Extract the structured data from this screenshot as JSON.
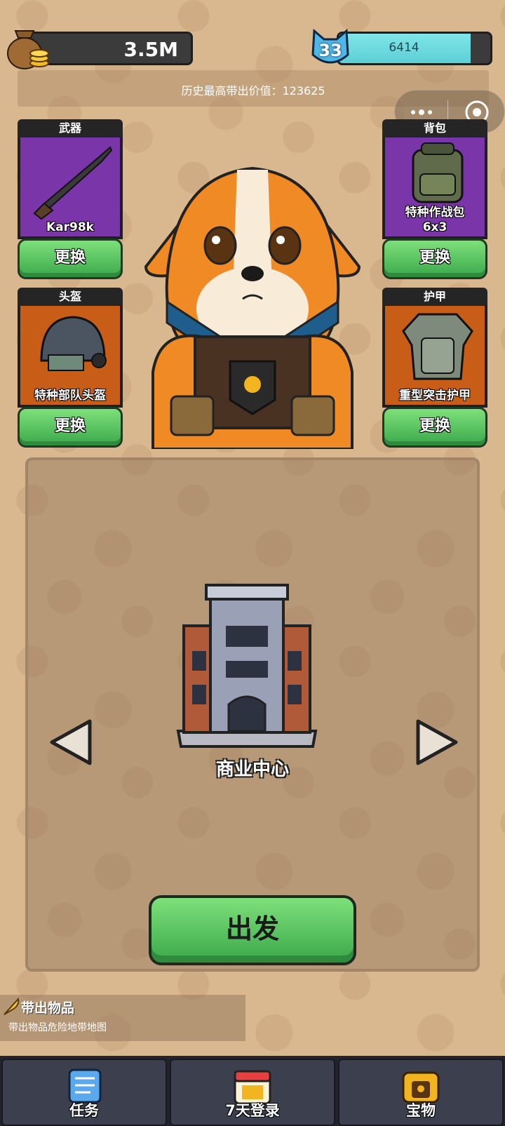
{
  "top": {
    "coins": "3.5M",
    "level": "33",
    "xp": "6414",
    "xp_progress": 0.87,
    "record_label": "历史最高带出价值：123625"
  },
  "equipment": {
    "weapon": {
      "header": "武器",
      "name": "Kar98k",
      "button": "更换"
    },
    "backpack": {
      "header": "背包",
      "name": "特种作战包\n6x3",
      "button": "更换"
    },
    "helmet": {
      "header": "头盔",
      "name": "特种部队头盔",
      "button": "更换"
    },
    "armor": {
      "header": "护甲",
      "name": "重型突击护甲",
      "button": "更换"
    }
  },
  "map": {
    "name": "商业中心",
    "go_label": "出发"
  },
  "carry": {
    "title": "带出物品",
    "desc": "带出物品危险地带地图"
  },
  "nav": [
    {
      "label": "任务",
      "icon": "scroll-icon"
    },
    {
      "label": "7天登录",
      "icon": "calendar-icon"
    },
    {
      "label": "宝物",
      "icon": "treasure-chest-icon"
    }
  ],
  "colors": {
    "green_button": "#3aa84a",
    "xp_fill": "#5ccfd4",
    "slot_purple": "#7a35a8",
    "slot_orange": "#c85d18"
  }
}
